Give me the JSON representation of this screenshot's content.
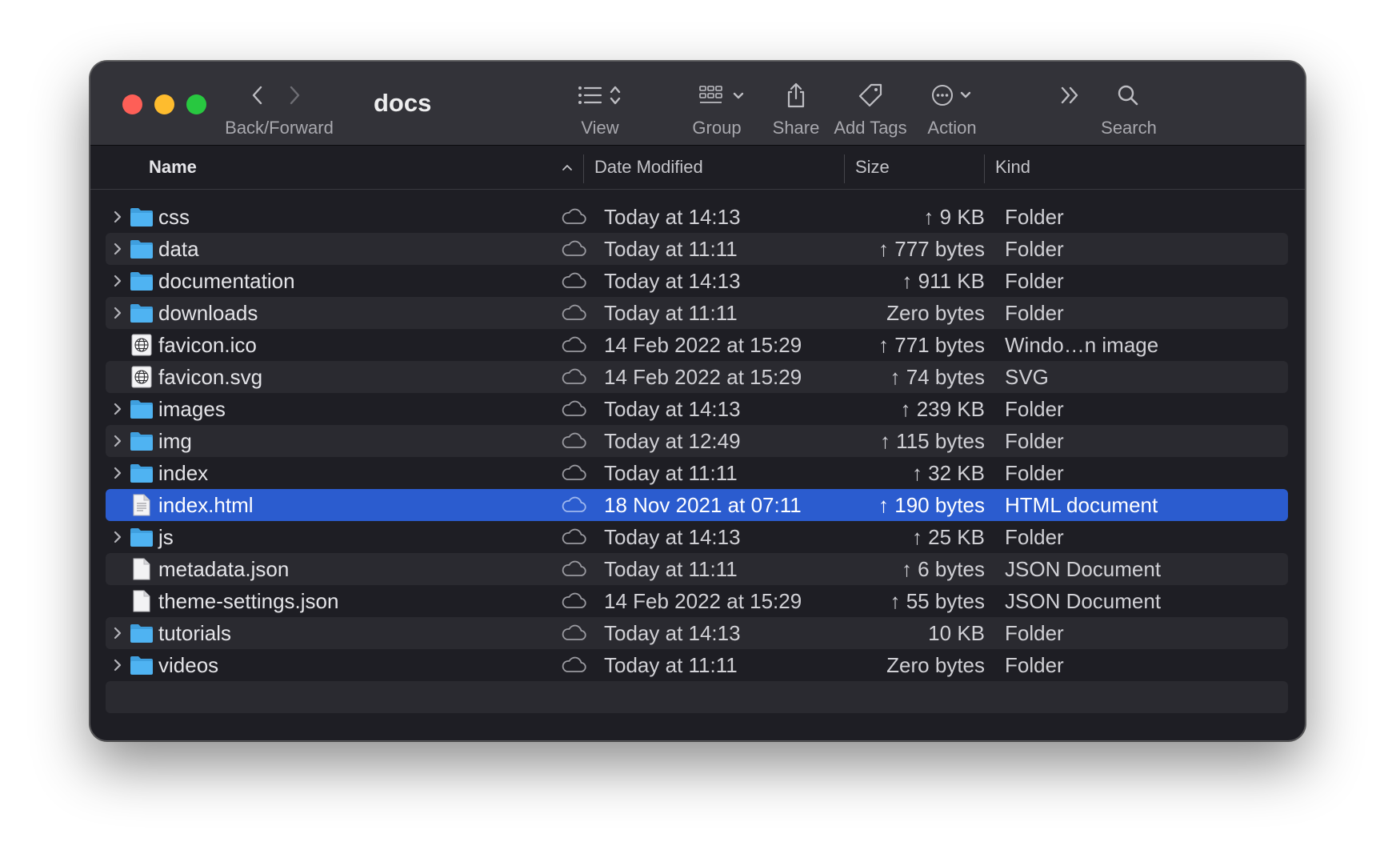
{
  "window": {
    "title": "docs"
  },
  "toolbar": {
    "back_forward_label": "Back/Forward",
    "view_label": "View",
    "group_label": "Group",
    "share_label": "Share",
    "add_tags_label": "Add Tags",
    "action_label": "Action",
    "search_label": "Search"
  },
  "columns": {
    "name": "Name",
    "date_modified": "Date Modified",
    "size": "Size",
    "kind": "Kind"
  },
  "colors": {
    "selection": "#2b5ccf",
    "folder": "#4fb3f2",
    "close": "#fe5f57",
    "minimize": "#febc2e",
    "zoom": "#28c840"
  },
  "files": [
    {
      "name": "css",
      "date": "Today at 14:13",
      "size": "↑ 9 KB",
      "kind": "Folder",
      "type": "folder",
      "icon": "folder-icon"
    },
    {
      "name": "data",
      "date": "Today at 11:11",
      "size": "↑ 777 bytes",
      "kind": "Folder",
      "type": "folder",
      "icon": "folder-icon"
    },
    {
      "name": "documentation",
      "date": "Today at 14:13",
      "size": "↑ 911 KB",
      "kind": "Folder",
      "type": "folder",
      "icon": "folder-icon"
    },
    {
      "name": "downloads",
      "date": "Today at 11:11",
      "size": "Zero bytes",
      "kind": "Folder",
      "type": "folder",
      "icon": "folder-icon"
    },
    {
      "name": "favicon.ico",
      "date": "14 Feb 2022 at 15:29",
      "size": "↑ 771 bytes",
      "kind": "Windo…n image",
      "type": "globe",
      "icon": "globe-file-icon"
    },
    {
      "name": "favicon.svg",
      "date": "14 Feb 2022 at 15:29",
      "size": "↑ 74 bytes",
      "kind": "SVG",
      "type": "globe",
      "icon": "globe-file-icon"
    },
    {
      "name": "images",
      "date": "Today at 14:13",
      "size": "↑ 239 KB",
      "kind": "Folder",
      "type": "folder",
      "icon": "folder-icon"
    },
    {
      "name": "img",
      "date": "Today at 12:49",
      "size": "↑ 115 bytes",
      "kind": "Folder",
      "type": "folder",
      "icon": "folder-icon"
    },
    {
      "name": "index",
      "date": "Today at 11:11",
      "size": "↑ 32 KB",
      "kind": "Folder",
      "type": "folder",
      "icon": "folder-icon"
    },
    {
      "name": "index.html",
      "date": "18 Nov 2021 at 07:11",
      "size": "↑ 190 bytes",
      "kind": "HTML document",
      "type": "html",
      "icon": "html-file-icon",
      "selected": true
    },
    {
      "name": "js",
      "date": "Today at 14:13",
      "size": "↑ 25 KB",
      "kind": "Folder",
      "type": "folder",
      "icon": "folder-icon"
    },
    {
      "name": "metadata.json",
      "date": "Today at 11:11",
      "size": "↑ 6 bytes",
      "kind": "JSON Document",
      "type": "doc",
      "icon": "document-icon"
    },
    {
      "name": "theme-settings.json",
      "date": "14 Feb 2022 at 15:29",
      "size": "↑ 55 bytes",
      "kind": "JSON Document",
      "type": "doc",
      "icon": "document-icon"
    },
    {
      "name": "tutorials",
      "date": "Today at 14:13",
      "size": "10 KB",
      "kind": "Folder",
      "type": "folder",
      "icon": "folder-icon"
    },
    {
      "name": "videos",
      "date": "Today at 11:11",
      "size": "Zero bytes",
      "kind": "Folder",
      "type": "folder",
      "icon": "folder-icon"
    }
  ]
}
